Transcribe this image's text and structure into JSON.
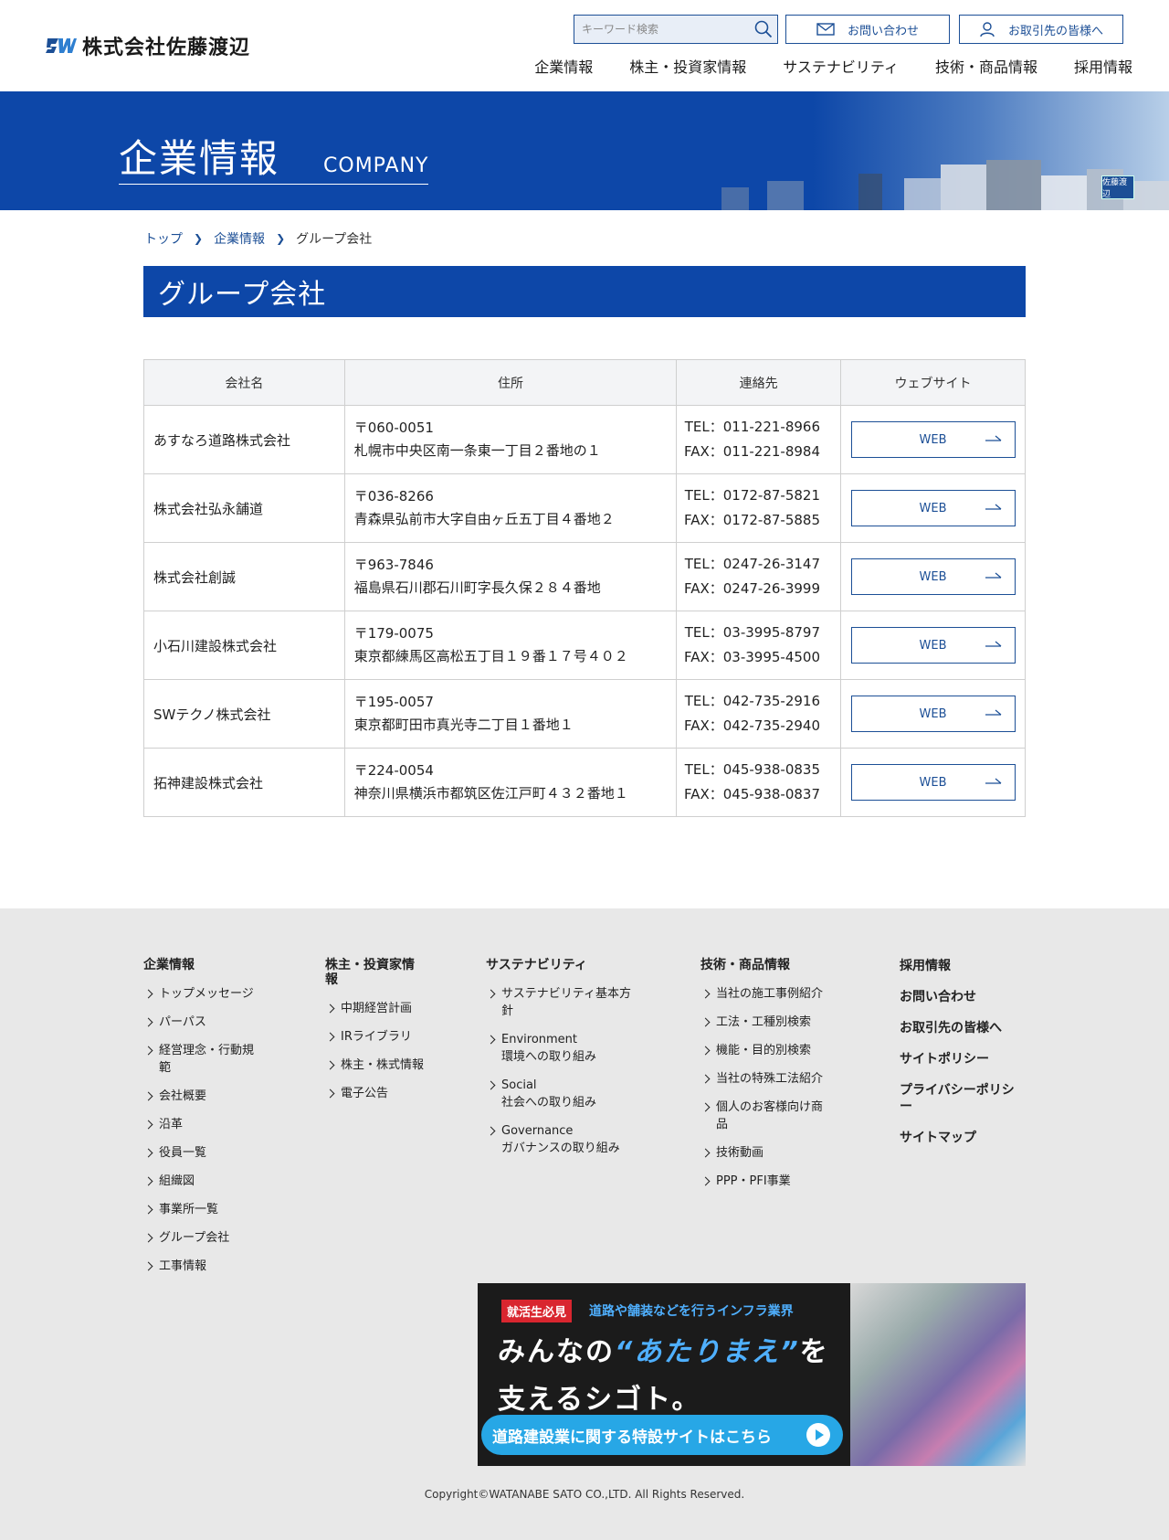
{
  "header": {
    "logo_text": "株式会社佐藤渡辺",
    "search_placeholder": "キーワード検索",
    "contact_label": "お問い合わせ",
    "partners_label": "お取引先の皆様へ",
    "nav": [
      "企業情報",
      "株主・投資家情報",
      "サステナビリティ",
      "技術・商品情報",
      "採用情報"
    ]
  },
  "hero": {
    "title_jp": "企業情報",
    "title_en": "COMPANY",
    "sign_text": "佐藤渡辺"
  },
  "breadcrumb": {
    "items": [
      "トップ",
      "企業情報"
    ],
    "current": "グループ会社"
  },
  "page_title": "グループ会社",
  "table": {
    "headers": [
      "会社名",
      "住所",
      "連絡先",
      "ウェブサイト"
    ],
    "web_label": "WEB",
    "rows": [
      {
        "name": "あすなろ道路株式会社",
        "zip": "〒060-0051",
        "addr": "札幌市中央区南一条東一丁目２番地の１",
        "tel": "TEL：011-221-8966",
        "fax": "FAX：011-221-8984"
      },
      {
        "name": "株式会社弘永舗道",
        "zip": "〒036-8266",
        "addr": "青森県弘前市大字自由ヶ丘五丁目４番地２",
        "tel": "TEL：0172-87-5821",
        "fax": "FAX：0172-87-5885"
      },
      {
        "name": "株式会社創誠",
        "zip": "〒963-7846",
        "addr": "福島県石川郡石川町字長久保２８４番地",
        "tel": "TEL：0247-26-3147",
        "fax": "FAX：0247-26-3999"
      },
      {
        "name": "小石川建設株式会社",
        "zip": "〒179-0075",
        "addr": "東京都練馬区高松五丁目１９番１７号４０２",
        "tel": "TEL：03-3995-8797",
        "fax": "FAX：03-3995-4500"
      },
      {
        "name": "SWテクノ株式会社",
        "zip": "〒195-0057",
        "addr": "東京都町田市真光寺二丁目１番地１",
        "tel": "TEL：042-735-2916",
        "fax": "FAX：042-735-2940"
      },
      {
        "name": "拓神建設株式会社",
        "zip": "〒224-0054",
        "addr": "神奈川県横浜市都筑区佐江戸町４３２番地１",
        "tel": "TEL：045-938-0835",
        "fax": "FAX：045-938-0837"
      }
    ]
  },
  "footer": {
    "col1": {
      "title": "企業情報",
      "links": [
        "トップメッセージ",
        "パーパス",
        "経営理念・行動規範",
        "会社概要",
        "沿革",
        "役員一覧",
        "組織図",
        "事業所一覧",
        "グループ会社",
        "工事情報"
      ]
    },
    "col2": {
      "title": "株主・投資家情報",
      "links": [
        "中期経営計画",
        "IRライブラリ",
        "株主・株式情報",
        "電子公告"
      ]
    },
    "col3": {
      "title": "サステナビリティ",
      "links": [
        {
          "l1": "サステナビリティ基本方針",
          "l2": ""
        },
        {
          "l1": "Environment",
          "l2": "環境への取り組み"
        },
        {
          "l1": "Social",
          "l2": "社会への取り組み"
        },
        {
          "l1": "Governance",
          "l2": "ガバナンスの取り組み"
        }
      ]
    },
    "col4": {
      "title": "技術・商品情報",
      "links": [
        "当社の施工事例紹介",
        "工法・工種別検索",
        "機能・目的別検索",
        "当社の特殊工法紹介",
        "個人のお客様向け商品",
        "技術動画",
        "PPP・PFI事業"
      ]
    },
    "col5": {
      "links": [
        "採用情報",
        "お問い合わせ",
        "お取引先の皆様へ",
        "サイトポリシー",
        "プライバシーポリシー",
        "サイトマップ"
      ]
    },
    "banner": {
      "tag": "就活生必見",
      "sub": "道路や舗装などを行うインフラ業界",
      "line1_a": "みんなの",
      "line1_hl": "“あたりまえ”",
      "line1_b": "を",
      "line2": "支えるシゴト。",
      "cta": "道路建設業に関する特設サイトはこちら"
    },
    "copyright": "Copyright©WATANABE SATO CO.,LTD. All Rights Reserved."
  },
  "colors": {
    "brand_blue": "#0d47a8",
    "link_blue": "#1c4f96",
    "footer_bg": "#e8e8e8"
  }
}
